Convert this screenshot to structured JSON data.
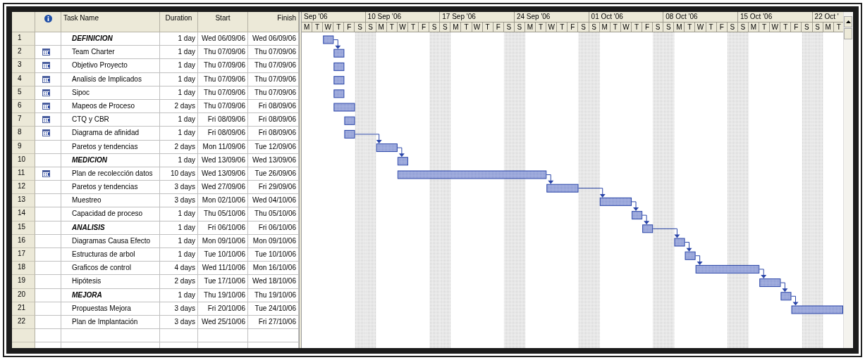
{
  "table": {
    "columns": [
      "Task Name",
      "Duration",
      "Start",
      "Finish"
    ],
    "rows": [
      {
        "number": "1",
        "kind": "phase",
        "indicator": false,
        "name": "DEFINICION",
        "duration": "1 day",
        "start": "Wed 06/09/06",
        "finish": "Wed 06/09/06",
        "linked": false
      },
      {
        "number": "2",
        "kind": "task",
        "indicator": true,
        "name": "Team Charter",
        "duration": "1 day",
        "start": "Thu 07/09/06",
        "finish": "Thu 07/09/06",
        "linked": true
      },
      {
        "number": "3",
        "kind": "task",
        "indicator": true,
        "name": "Objetivo Proyecto",
        "duration": "1 day",
        "start": "Thu 07/09/06",
        "finish": "Thu 07/09/06",
        "linked": false
      },
      {
        "number": "4",
        "kind": "task",
        "indicator": true,
        "name": "Analisis de Implicados",
        "duration": "1 day",
        "start": "Thu 07/09/06",
        "finish": "Thu 07/09/06",
        "linked": false
      },
      {
        "number": "5",
        "kind": "task",
        "indicator": true,
        "name": "Sipoc",
        "duration": "1 day",
        "start": "Thu 07/09/06",
        "finish": "Thu 07/09/06",
        "linked": false
      },
      {
        "number": "6",
        "kind": "task",
        "indicator": true,
        "name": "Mapeos de Proceso",
        "duration": "2 days",
        "start": "Thu 07/09/06",
        "finish": "Fri 08/09/06",
        "linked": false
      },
      {
        "number": "7",
        "kind": "task",
        "indicator": true,
        "name": "CTQ y CBR",
        "duration": "1 day",
        "start": "Fri 08/09/06",
        "finish": "Fri 08/09/06",
        "linked": false
      },
      {
        "number": "8",
        "kind": "task",
        "indicator": true,
        "name": "Diagrama de afinidad",
        "duration": "1 day",
        "start": "Fri 08/09/06",
        "finish": "Fri 08/09/06",
        "linked": false
      },
      {
        "number": "9",
        "kind": "task",
        "indicator": false,
        "name": "Paretos y tendencias",
        "duration": "2 days",
        "start": "Mon 11/09/06",
        "finish": "Tue 12/09/06",
        "linked": true
      },
      {
        "number": "10",
        "kind": "phase",
        "indicator": false,
        "name": "MEDICION",
        "duration": "1 day",
        "start": "Wed 13/09/06",
        "finish": "Wed 13/09/06",
        "linked": true
      },
      {
        "number": "11",
        "kind": "task",
        "indicator": true,
        "name": "Plan de recolección datos",
        "duration": "10 days",
        "start": "Wed 13/09/06",
        "finish": "Tue 26/09/06",
        "linked": false
      },
      {
        "number": "12",
        "kind": "task",
        "indicator": false,
        "name": "Paretos y tendencias",
        "duration": "3 days",
        "start": "Wed 27/09/06",
        "finish": "Fri 29/09/06",
        "linked": true
      },
      {
        "number": "13",
        "kind": "task",
        "indicator": false,
        "name": "Muestreo",
        "duration": "3 days",
        "start": "Mon 02/10/06",
        "finish": "Wed 04/10/06",
        "linked": true
      },
      {
        "number": "14",
        "kind": "task",
        "indicator": false,
        "name": "Capacidad de proceso",
        "duration": "1 day",
        "start": "Thu 05/10/06",
        "finish": "Thu 05/10/06",
        "linked": true
      },
      {
        "number": "15",
        "kind": "phase",
        "indicator": false,
        "name": "ANALISIS",
        "duration": "1 day",
        "start": "Fri 06/10/06",
        "finish": "Fri 06/10/06",
        "linked": true
      },
      {
        "number": "16",
        "kind": "task",
        "indicator": false,
        "name": "Diagramas Causa Efecto",
        "duration": "1 day",
        "start": "Mon 09/10/06",
        "finish": "Mon 09/10/06",
        "linked": true
      },
      {
        "number": "17",
        "kind": "task",
        "indicator": false,
        "name": "Estructuras de arbol",
        "duration": "1 day",
        "start": "Tue 10/10/06",
        "finish": "Tue 10/10/06",
        "linked": true
      },
      {
        "number": "18",
        "kind": "task",
        "indicator": false,
        "name": "Graficos de control",
        "duration": "4 days",
        "start": "Wed 11/10/06",
        "finish": "Mon 16/10/06",
        "linked": true
      },
      {
        "number": "19",
        "kind": "task",
        "indicator": false,
        "name": "Hipótesis",
        "duration": "2 days",
        "start": "Tue 17/10/06",
        "finish": "Wed 18/10/06",
        "linked": true
      },
      {
        "number": "20",
        "kind": "phase",
        "indicator": false,
        "name": "MEJORA",
        "duration": "1 day",
        "start": "Thu 19/10/06",
        "finish": "Thu 19/10/06",
        "linked": true
      },
      {
        "number": "21",
        "kind": "task",
        "indicator": false,
        "name": "Propuestas Mejora",
        "duration": "3 days",
        "start": "Fri 20/10/06",
        "finish": "Tue 24/10/06",
        "linked": true
      },
      {
        "number": "22",
        "kind": "task",
        "indicator": false,
        "name": "Plan de Implantación",
        "duration": "3 days",
        "start": "Wed 25/10/06",
        "finish": "Fri 27/10/06"
      }
    ]
  },
  "timeline": {
    "weeks": [
      {
        "label": "Sep '06",
        "days": [
          {
            "label": "M",
            "weekend": false
          },
          {
            "label": "T",
            "weekend": false
          },
          {
            "label": "W",
            "weekend": false
          },
          {
            "label": "T",
            "weekend": false
          },
          {
            "label": "F",
            "weekend": false
          },
          {
            "label": "S",
            "weekend": true
          }
        ]
      },
      {
        "label": "10 Sep '06",
        "days": [
          {
            "label": "S",
            "weekend": true
          },
          {
            "label": "M",
            "weekend": false
          },
          {
            "label": "T",
            "weekend": false
          },
          {
            "label": "W",
            "weekend": false
          },
          {
            "label": "T",
            "weekend": false
          },
          {
            "label": "F",
            "weekend": false
          },
          {
            "label": "S",
            "weekend": true
          }
        ]
      },
      {
        "label": "17 Sep '06",
        "days": [
          {
            "label": "S",
            "weekend": true
          },
          {
            "label": "M",
            "weekend": false
          },
          {
            "label": "T",
            "weekend": false
          },
          {
            "label": "W",
            "weekend": false
          },
          {
            "label": "T",
            "weekend": false
          },
          {
            "label": "F",
            "weekend": false
          },
          {
            "label": "S",
            "weekend": true
          }
        ]
      },
      {
        "label": "24 Sep '06",
        "days": [
          {
            "label": "S",
            "weekend": true
          },
          {
            "label": "M",
            "weekend": false
          },
          {
            "label": "T",
            "weekend": false
          },
          {
            "label": "W",
            "weekend": false
          },
          {
            "label": "T",
            "weekend": false
          },
          {
            "label": "F",
            "weekend": false
          },
          {
            "label": "S",
            "weekend": true
          }
        ]
      },
      {
        "label": "01 Oct '06",
        "days": [
          {
            "label": "S",
            "weekend": true
          },
          {
            "label": "M",
            "weekend": false
          },
          {
            "label": "T",
            "weekend": false
          },
          {
            "label": "W",
            "weekend": false
          },
          {
            "label": "T",
            "weekend": false
          },
          {
            "label": "F",
            "weekend": false
          },
          {
            "label": "S",
            "weekend": true
          }
        ]
      },
      {
        "label": "08 Oct '06",
        "days": [
          {
            "label": "S",
            "weekend": true
          },
          {
            "label": "M",
            "weekend": false
          },
          {
            "label": "T",
            "weekend": false
          },
          {
            "label": "W",
            "weekend": false
          },
          {
            "label": "T",
            "weekend": false
          },
          {
            "label": "F",
            "weekend": false
          },
          {
            "label": "S",
            "weekend": true
          }
        ]
      },
      {
        "label": "15 Oct '06",
        "days": [
          {
            "label": "S",
            "weekend": true
          },
          {
            "label": "M",
            "weekend": false
          },
          {
            "label": "T",
            "weekend": false
          },
          {
            "label": "W",
            "weekend": false
          },
          {
            "label": "T",
            "weekend": false
          },
          {
            "label": "F",
            "weekend": false
          },
          {
            "label": "S",
            "weekend": true
          }
        ]
      },
      {
        "label": "22 Oct '",
        "days": [
          {
            "label": "S",
            "weekend": true
          },
          {
            "label": "M",
            "weekend": false
          },
          {
            "label": "T",
            "weekend": false
          }
        ]
      }
    ]
  }
}
